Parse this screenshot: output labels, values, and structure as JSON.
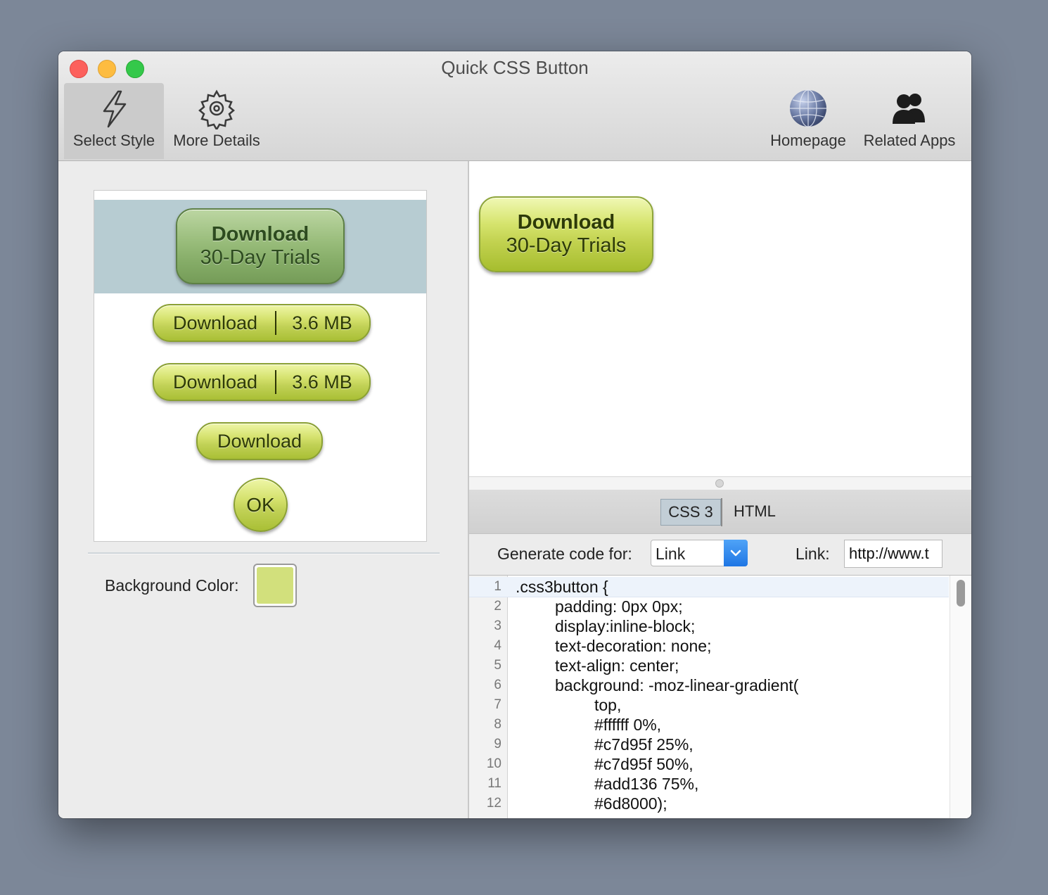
{
  "window": {
    "title": "Quick CSS Button"
  },
  "toolbar": {
    "select_style": "Select Style",
    "more_details": "More Details",
    "homepage": "Homepage",
    "related_apps": "Related Apps"
  },
  "styles": {
    "big_line1": "Download",
    "big_line2": "30-Day Trials",
    "split1_left": "Download",
    "split1_right": "3.6 MB",
    "split2_left": "Download",
    "split2_right": "3.6 MB",
    "single": "Download",
    "ok": "OK"
  },
  "background": {
    "label": "Background Color:",
    "color": "#d2e07c"
  },
  "preview": {
    "line1": "Download",
    "line2": "30-Day Trials"
  },
  "code_tabs": {
    "css": "CSS 3",
    "html": "HTML"
  },
  "generate": {
    "label": "Generate code for:",
    "selected": "Link",
    "link_label": "Link:",
    "link_value": "http://www.t"
  },
  "code_lines": [
    {
      "n": "1",
      "text": ".css3button {",
      "indent": 0
    },
    {
      "n": "2",
      "text": "padding: 0px 0px;",
      "indent": 1
    },
    {
      "n": "3",
      "text": "display:inline-block;",
      "indent": 1
    },
    {
      "n": "4",
      "text": "text-decoration: none;",
      "indent": 1
    },
    {
      "n": "5",
      "text": "text-align: center;",
      "indent": 1
    },
    {
      "n": "6",
      "text": "background: -moz-linear-gradient(",
      "indent": 1
    },
    {
      "n": "7",
      "text": "top,",
      "indent": 2
    },
    {
      "n": "8",
      "text": "#ffffff 0%,",
      "indent": 2
    },
    {
      "n": "9",
      "text": "#c7d95f 25%,",
      "indent": 2
    },
    {
      "n": "10",
      "text": "#c7d95f 50%,",
      "indent": 2
    },
    {
      "n": "11",
      "text": "#add136 75%,",
      "indent": 2
    },
    {
      "n": "12",
      "text": "#6d8000);",
      "indent": 2
    }
  ],
  "colors": {
    "accent": "#2f7fe6",
    "button_green": "#c7d95f",
    "selection_bg": "#b7ccd2"
  }
}
